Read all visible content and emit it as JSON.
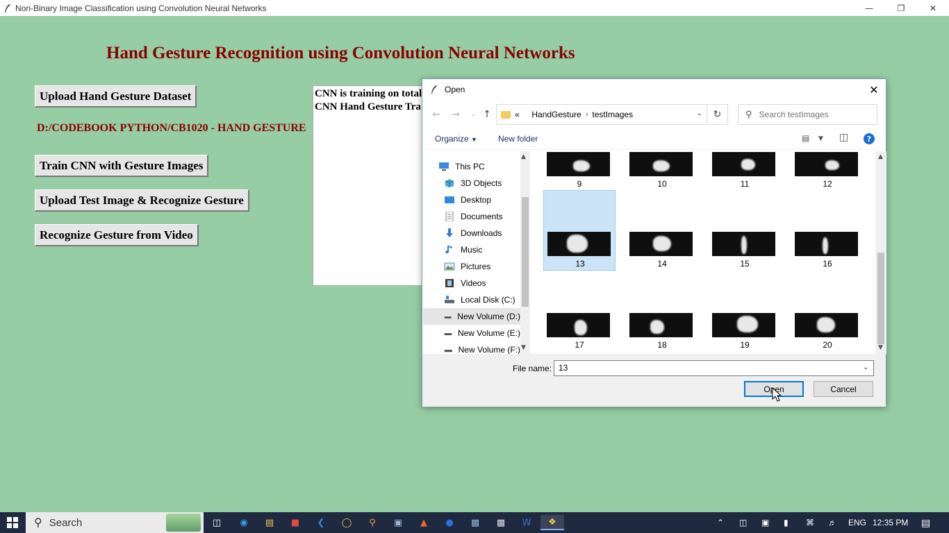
{
  "window": {
    "title": "Non-Binary Image Classification using Convolution Neural Networks",
    "controls": [
      "minimize",
      "restore",
      "close"
    ]
  },
  "app": {
    "heading": "Hand Gesture Recognition using Convolution Neural Networks",
    "buttons": {
      "upload_dataset": "Upload Hand Gesture Dataset",
      "train": "Train CNN with Gesture Images",
      "upload_test": "Upload Test Image & Recognize Gesture",
      "video": "Recognize Gesture from Video"
    },
    "path": "D:/CODEBOOK PYTHON/CB1020 - HAND GESTURE",
    "text_area": [
      "CNN is training on total",
      "CNN Hand Gesture Tra"
    ]
  },
  "dialog": {
    "title": "Open",
    "address": {
      "prefix": "«",
      "crumbs": [
        "HandGesture",
        "testImages"
      ]
    },
    "search_placeholder": "Search testImages",
    "toolbar": {
      "organize": "Organize",
      "new_folder": "New folder",
      "help": "?"
    },
    "tree": [
      {
        "label": "This PC",
        "icon": "pc-icon"
      },
      {
        "label": "3D Objects",
        "icon": "cube-icon"
      },
      {
        "label": "Desktop",
        "icon": "desktop-icon"
      },
      {
        "label": "Documents",
        "icon": "document-icon"
      },
      {
        "label": "Downloads",
        "icon": "download-icon"
      },
      {
        "label": "Music",
        "icon": "music-icon"
      },
      {
        "label": "Pictures",
        "icon": "pictures-icon"
      },
      {
        "label": "Videos",
        "icon": "video-icon"
      },
      {
        "label": "Local Disk (C:)",
        "icon": "drive-icon"
      },
      {
        "label": "New Volume (D:)",
        "icon": "drive-icon",
        "selected": true
      },
      {
        "label": "New Volume (E:)",
        "icon": "drive-icon"
      },
      {
        "label": "New Volume (F:)",
        "icon": "drive-icon"
      }
    ],
    "files": [
      "9",
      "10",
      "11",
      "12",
      "13",
      "14",
      "15",
      "16",
      "17",
      "18",
      "19",
      "20"
    ],
    "selected_file": "13",
    "file_name_label": "File name:",
    "file_name_value": "13",
    "open_label": "Open",
    "cancel_label": "Cancel"
  },
  "taskbar": {
    "search_label": "Search",
    "language": "ENG",
    "time": "12:35 PM"
  }
}
